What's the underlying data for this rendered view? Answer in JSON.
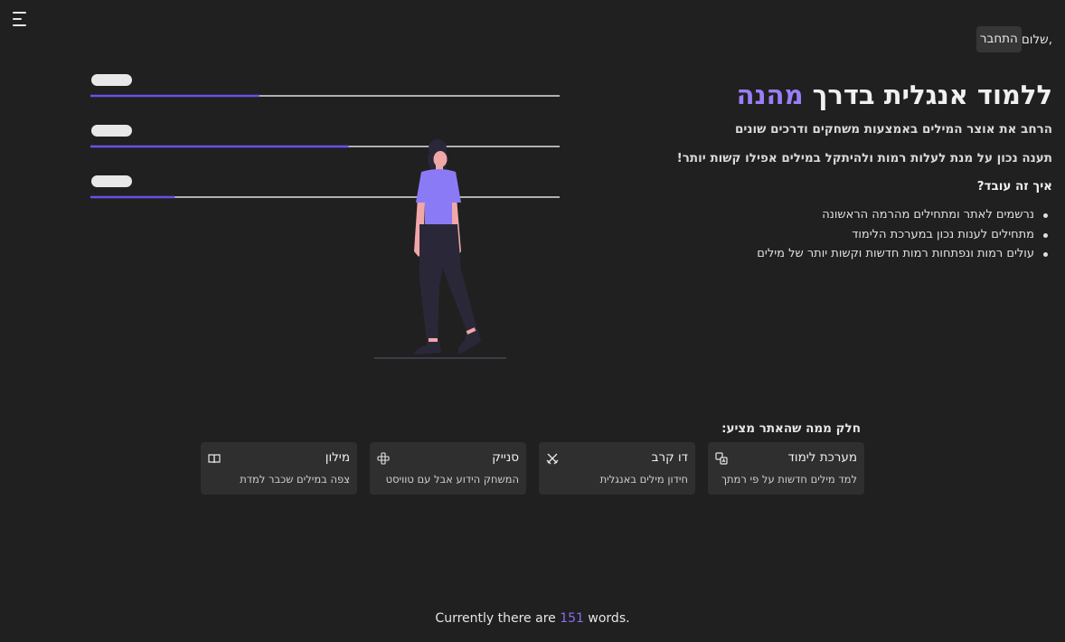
{
  "header": {
    "greeting": "שלום,",
    "login_label": "התחבר"
  },
  "hero": {
    "title_main": "ללמוד אנגלית בדרך ",
    "title_accent": "מהנה",
    "lead": "הרחב את אוצר המילים באמצעות משחקים ודרכים שונים",
    "lead2": "תענה נכון על מנת לעלות רמות ולהיתקל במילים אפילו קשות יותר!",
    "how_title": "איך זה עובד?",
    "steps": [
      "נרשמים לאתר ומתחילים מהרמה הראשונה",
      "מתחילים לענות נכון במערכת הלימוד",
      "עולים רמות ונפתחות רמות חדשות וקשות יותר של מילים"
    ]
  },
  "illustration": {
    "progress_levels": [
      0.36,
      0.55,
      0.18
    ]
  },
  "features": {
    "title": "חלק ממה שהאתר מציע:",
    "cards": [
      {
        "title": "מערכת לימוד",
        "desc": "למד מילים חדשות על פי רמתך",
        "icon": "translate-icon"
      },
      {
        "title": "דו קרב",
        "desc": "חידון מילים באנגלית",
        "icon": "swords-icon"
      },
      {
        "title": "סנייק",
        "desc": "המשחק הידוע אבל עם טוויסט",
        "icon": "gamepad-icon"
      },
      {
        "title": "מילון",
        "desc": "צפה במילים שכבר למדת",
        "icon": "book-icon"
      }
    ]
  },
  "footer": {
    "prefix": "Currently there are ",
    "count": "151",
    "suffix": " words."
  },
  "colors": {
    "background": "#202020",
    "accent": "#9b7ef7",
    "card": "#2f2f2f",
    "figure_shirt": "#8b7af5",
    "progress_fill": "#6c4fe8"
  }
}
